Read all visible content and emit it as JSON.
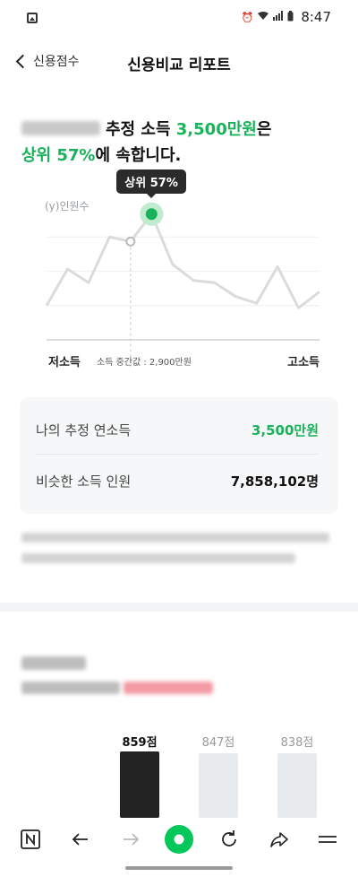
{
  "status_bar": {
    "time": "8:47"
  },
  "header": {
    "back_label": "신용점수",
    "title": "신용비교 리포트"
  },
  "headline": {
    "line1_prefix": "추정 소득 ",
    "income": "3,500만원",
    "line1_suffix": "은",
    "rank": "상위 57%",
    "line2_suffix": "에 속합니다."
  },
  "chart_data": {
    "type": "line",
    "ylabel": "(y)인원수",
    "x_low_label": "저소득",
    "x_high_label": "고소득",
    "median_label": "소득 중간값 : 2,900만원",
    "highlight_label": "상위 57%",
    "highlight_index": 5,
    "median_index": 4,
    "values": [
      1.5,
      3.1,
      2.5,
      4.5,
      4.3,
      5.5,
      3.3,
      2.6,
      2.5,
      1.9,
      1.6,
      3.2,
      1.4,
      2.1
    ]
  },
  "info_card": {
    "rows": [
      {
        "label": "나의 추정 연소득",
        "value": "3,500만원"
      },
      {
        "label": "비슷한 소득 인원",
        "value": "7,858,102명"
      }
    ]
  },
  "scores": {
    "items": [
      {
        "label": "859점",
        "highlight": true,
        "value": 859
      },
      {
        "label": "847점",
        "highlight": false,
        "value": 847
      },
      {
        "label": "838점",
        "highlight": false,
        "value": 838
      }
    ]
  },
  "colors": {
    "accent": "#18b35a",
    "dark": "#222222",
    "line": "#d9dbdd"
  }
}
